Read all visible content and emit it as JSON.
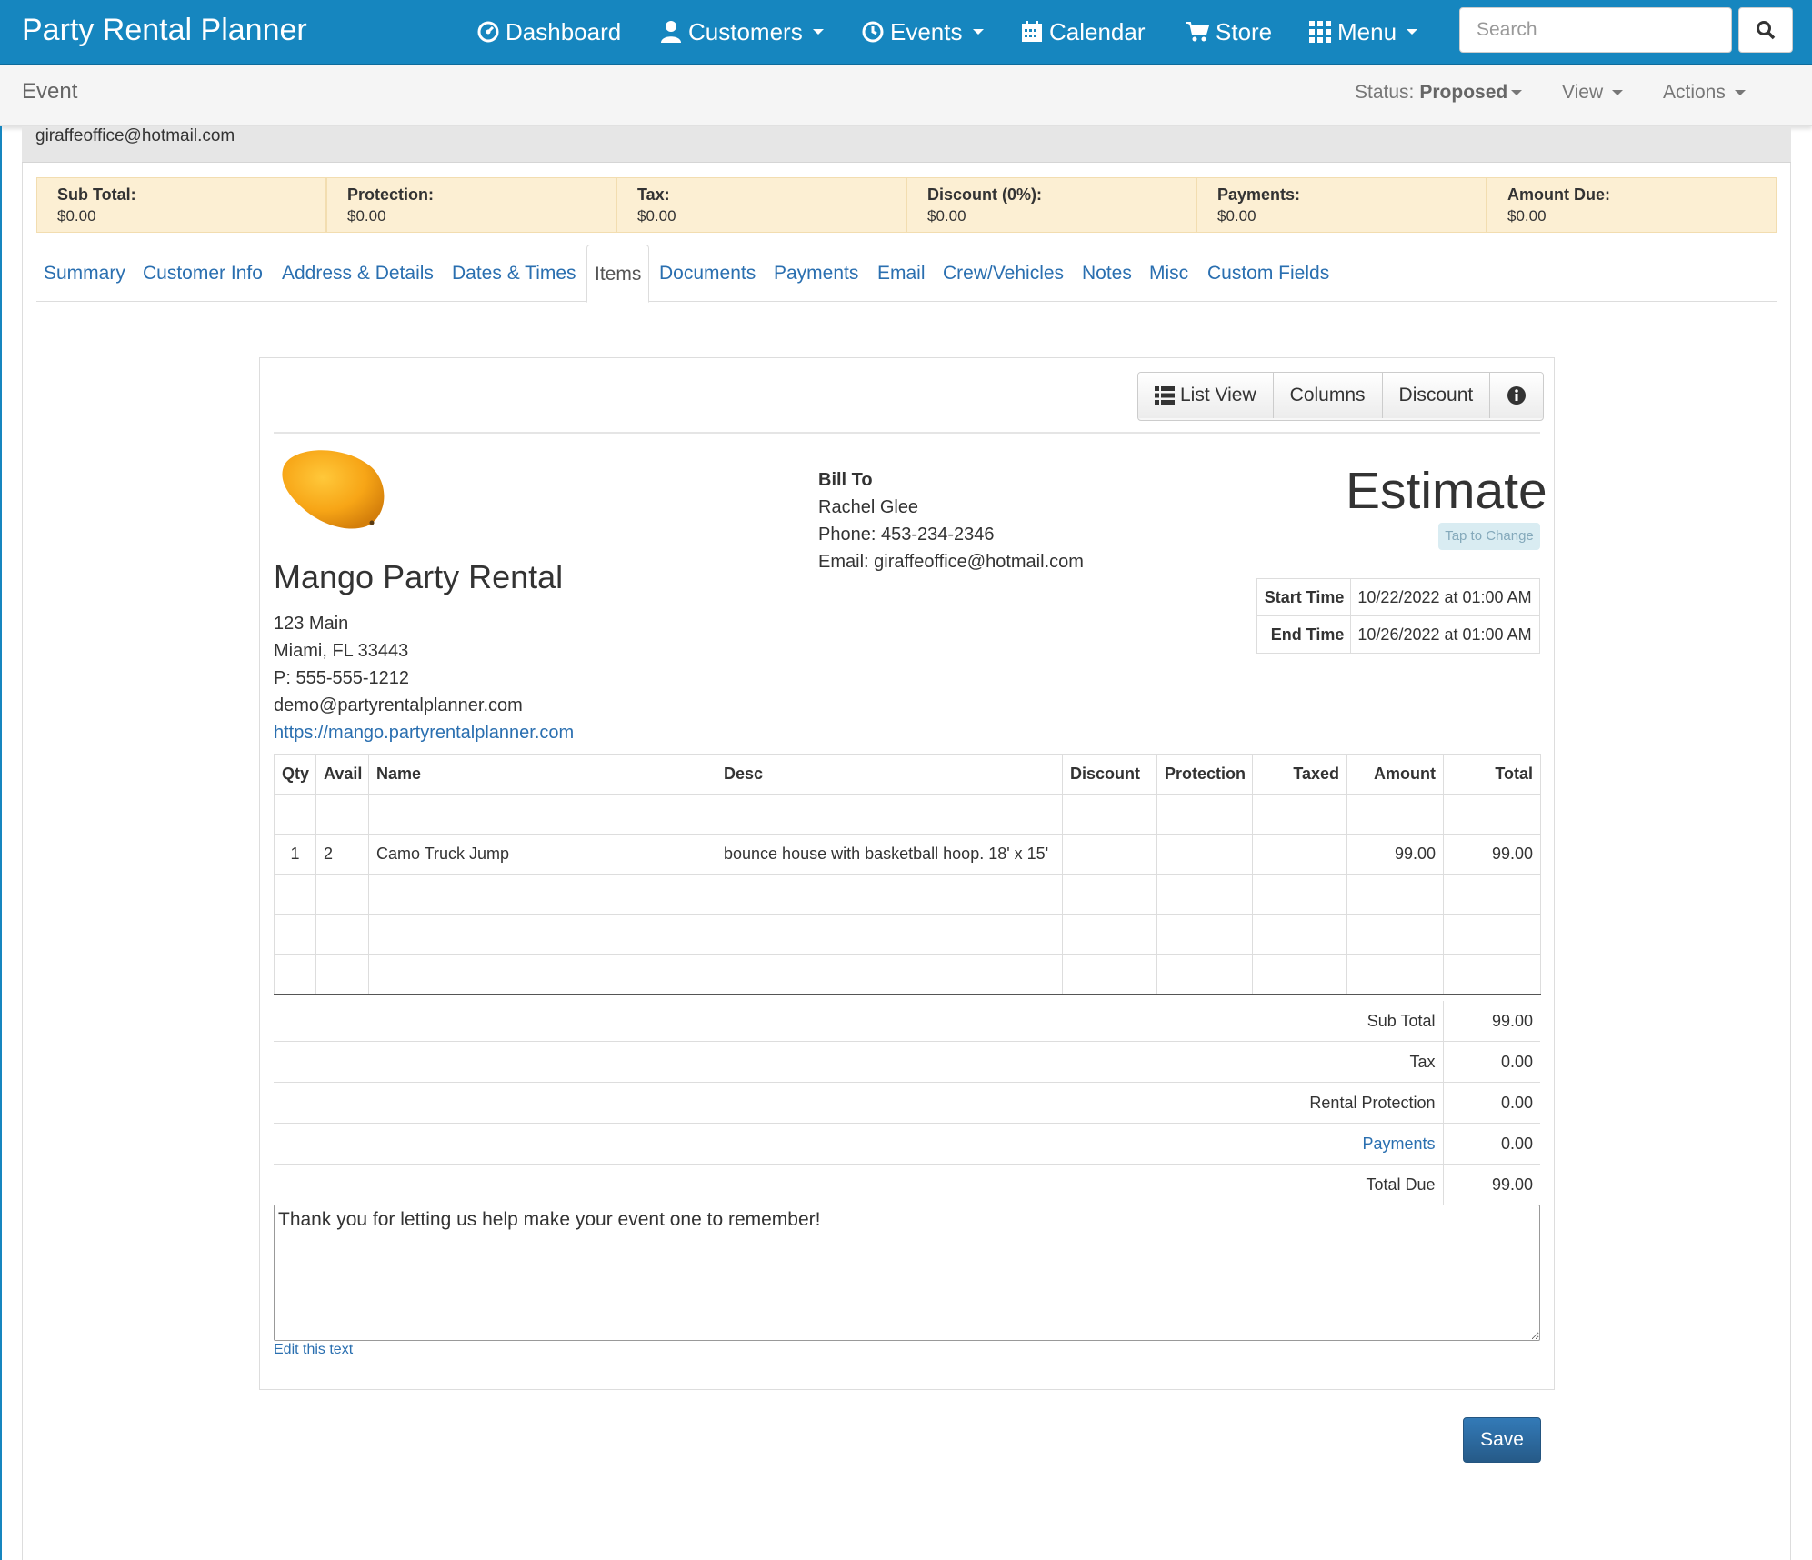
{
  "app": {
    "title": "Party Rental Planner"
  },
  "nav": {
    "dashboard": "Dashboard",
    "customers": "Customers",
    "events": "Events",
    "calendar": "Calendar",
    "store": "Store",
    "menu": "Menu",
    "search_placeholder": "Search"
  },
  "subheader": {
    "title": "Event",
    "status_label": "Status:",
    "status_value": "Proposed",
    "view": "View",
    "actions": "Actions"
  },
  "customer_email": "giraffeoffice@hotmail.com",
  "totals": [
    {
      "label": "Sub Total:",
      "value": "$0.00"
    },
    {
      "label": "Protection:",
      "value": "$0.00"
    },
    {
      "label": "Tax:",
      "value": "$0.00"
    },
    {
      "label": "Discount (0%):",
      "value": "$0.00"
    },
    {
      "label": "Payments:",
      "value": "$0.00"
    },
    {
      "label": "Amount Due:",
      "value": "$0.00"
    }
  ],
  "tabs": [
    "Summary",
    "Customer Info",
    "Address & Details",
    "Dates & Times",
    "Items",
    "Documents",
    "Payments",
    "Email",
    "Crew/Vehicles",
    "Notes",
    "Misc",
    "Custom Fields"
  ],
  "active_tab": "Items",
  "toolbar": {
    "list_view": "List View",
    "columns": "Columns",
    "discount": "Discount",
    "info_icon": "info-icon"
  },
  "company": {
    "name": "Mango Party Rental",
    "address1": "123 Main",
    "address2": "Miami, FL 33443",
    "phone": "P: 555-555-1212",
    "email": "demo@partyrentalplanner.com",
    "website": "https://mango.partyrentalplanner.com"
  },
  "bill_to": {
    "heading": "Bill To",
    "name": "Rachel Glee",
    "phone": "Phone: 453-234-2346",
    "email": "Email: giraffeoffice@hotmail.com"
  },
  "document": {
    "type": "Estimate",
    "tap_to_change": "Tap to Change",
    "start_label": "Start Time",
    "start_value": "10/22/2022 at 01:00 AM",
    "end_label": "End Time",
    "end_value": "10/26/2022 at 01:00 AM"
  },
  "items_table": {
    "headers": [
      "Qty",
      "Avail",
      "Name",
      "Desc",
      "Discount",
      "Protection",
      "Taxed",
      "Amount",
      "Total"
    ],
    "rows": [
      [
        "",
        "",
        "",
        "",
        "",
        "",
        "",
        "",
        ""
      ],
      [
        "1",
        "2",
        "Camo Truck Jump",
        "bounce house with basketball hoop. 18' x 15'",
        "",
        "",
        "",
        "99.00",
        "99.00"
      ],
      [
        "",
        "",
        "",
        "",
        "",
        "",
        "",
        "",
        ""
      ],
      [
        "",
        "",
        "",
        "",
        "",
        "",
        "",
        "",
        ""
      ],
      [
        "",
        "",
        "",
        "",
        "",
        "",
        "",
        "",
        ""
      ]
    ]
  },
  "summary": {
    "sub_total_label": "Sub Total",
    "sub_total": "99.00",
    "tax_label": "Tax",
    "tax": "0.00",
    "protection_label": "Rental Protection",
    "protection": "0.00",
    "payments_label": "Payments",
    "payments": "0.00",
    "total_due_label": "Total Due",
    "total_due": "99.00"
  },
  "footer_text": "Thank you for letting us help make your event one to remember!",
  "edit_text": "Edit this text",
  "save": "Save",
  "colors": {
    "navbar": "#1686bf",
    "link": "#2a6fb0",
    "totals_bg": "#fcefd3",
    "save": "#265a88"
  }
}
